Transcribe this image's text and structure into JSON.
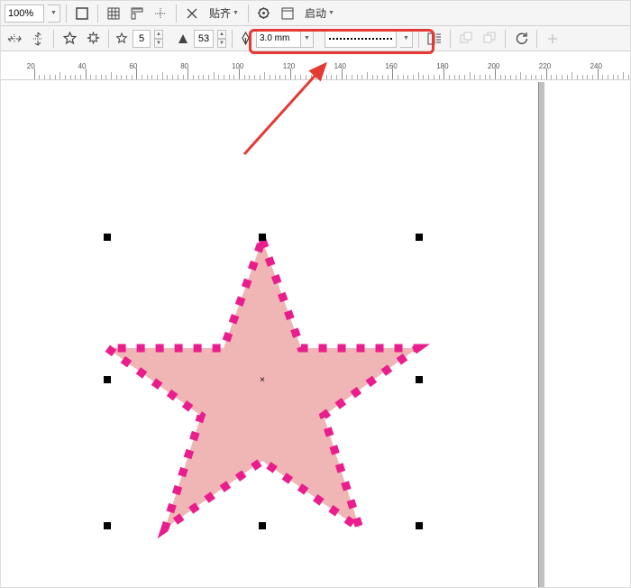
{
  "toolbar1": {
    "zoom_value": "100%",
    "snap_label": "贴齐",
    "launch_label": "启动"
  },
  "toolbar2": {
    "points_value": "5",
    "sharpness_value": "53",
    "stroke_width_value": "3.0 mm"
  },
  "ruler": {
    "ticks": [
      20,
      40,
      60,
      80,
      100,
      120,
      140,
      160,
      180,
      200,
      220,
      240
    ]
  },
  "shape": {
    "type": "star",
    "fill": "#f0b5b5",
    "stroke": "#e91e8c",
    "stroke_width": 9,
    "dash": "9,12"
  }
}
